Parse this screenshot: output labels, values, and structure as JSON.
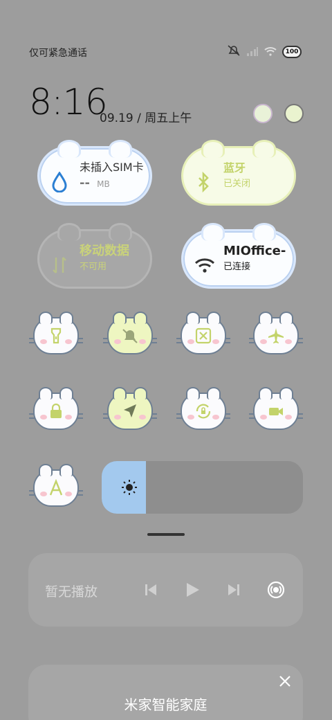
{
  "status": {
    "carrier": "仅可紧急通话",
    "battery": "100"
  },
  "clock": {
    "time": "8:16",
    "date": "09.19 / 周五上午"
  },
  "tiles": [
    {
      "title": "未插入SIM卡",
      "subtitle_value": "--",
      "subtitle_unit": "MB",
      "icon": "water-drop-icon"
    },
    {
      "title": "蓝牙",
      "subtitle": "已关闭",
      "icon": "bluetooth-icon"
    },
    {
      "title": "移动数据",
      "subtitle": "不可用",
      "icon": "mobile-data-icon"
    },
    {
      "title": "MIOffice-",
      "subtitle": "已连接",
      "icon": "wifi-icon"
    }
  ],
  "toggles": [
    {
      "name": "flashlight",
      "icon": "flashlight-icon",
      "active": false
    },
    {
      "name": "mute",
      "icon": "bell-off-icon",
      "active": true
    },
    {
      "name": "screenshot",
      "icon": "screenshot-icon",
      "active": false
    },
    {
      "name": "airplane-mode",
      "icon": "airplane-icon",
      "active": false
    },
    {
      "name": "lock-screen",
      "icon": "lock-icon",
      "active": false
    },
    {
      "name": "location",
      "icon": "location-arrow-icon",
      "active": true
    },
    {
      "name": "auto-rotate",
      "icon": "rotation-lock-icon",
      "active": false
    },
    {
      "name": "screen-record",
      "icon": "video-camera-icon",
      "active": false
    },
    {
      "name": "font-size",
      "icon": "letter-a-icon",
      "active": false
    }
  ],
  "brightness": {
    "level": 0.22,
    "icon": "sun-icon"
  },
  "media": {
    "title": "暂无播放",
    "controls": [
      "previous-icon",
      "play-icon",
      "next-icon",
      "cast-icon"
    ]
  },
  "home": {
    "title": "米家智能家庭"
  },
  "colors": {
    "background": "#9d9d9d",
    "accent_green": "#c3d36a",
    "accent_blue": "#2b7fd3",
    "brightness_fill": "#a3c9ee"
  }
}
